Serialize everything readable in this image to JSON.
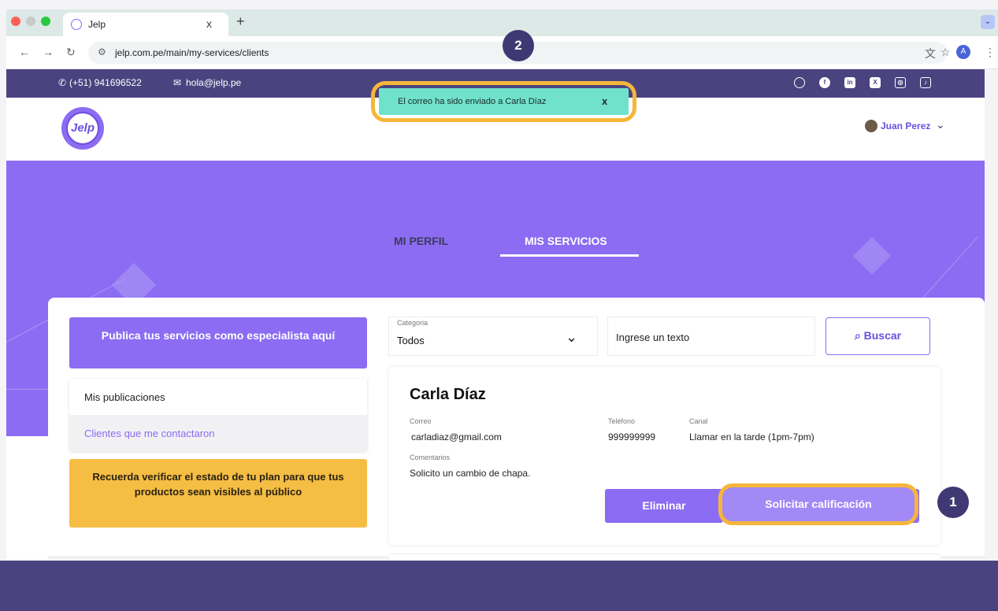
{
  "browser": {
    "tab_title": "Jelp",
    "tab_close": "x",
    "new_tab": "+",
    "tab_menu": "⌄",
    "url": "jelp.com.pe/main/my-services/clients",
    "profile_initial": "A"
  },
  "topbar": {
    "phone": "(+51) 941696522",
    "email": "hola@jelp.pe",
    "socials": [
      "whatsapp-icon",
      "facebook-icon",
      "linkedin-icon",
      "x-icon",
      "instagram-icon",
      "tiktok-icon"
    ]
  },
  "header": {
    "logo_text": "Jelp",
    "user_name": "Juan Perez"
  },
  "toast": {
    "message": "El correo ha sido enviado a Carla Díaz",
    "close": "x"
  },
  "badges": {
    "one": "1",
    "two": "2"
  },
  "profile_tabs": {
    "perfil": "MI PERFIL",
    "servicios": "MIS SERVICIOS",
    "active": "servicios"
  },
  "sidebar": {
    "publish": "Publica tus servicios como especialista aquí",
    "items": [
      {
        "label": "Mis publicaciones"
      },
      {
        "label": "Clientes que me contactaron"
      }
    ],
    "notice": "Recuerda verificar el estado de tu plan para que tus productos sean visibles al público"
  },
  "filters": {
    "category_label": "Categoria",
    "category_value": "Todos",
    "search_value": "Ingrese un texto",
    "search_button": "Buscar"
  },
  "client": {
    "name": "Carla Díaz",
    "correo_label": "Correo",
    "correo": "carladiaz@gmail.com",
    "telefono_label": "Teléfono",
    "telefono": "999999999",
    "canal_label": "Canal",
    "canal": "Llamar en la tarde (1pm-7pm)",
    "comentarios_label": "Comentarios",
    "comentarios": "Solicito un cambio de chapa.",
    "delete_button": "Eliminar",
    "rating_button": "Solicitar calificación"
  },
  "colors": {
    "brand_purple": "#8b6cf2",
    "dark_purple": "#4a4380",
    "toast_teal": "#70e2cc",
    "highlight_orange": "#f5b63a",
    "notice_yellow": "#f5bd43"
  }
}
